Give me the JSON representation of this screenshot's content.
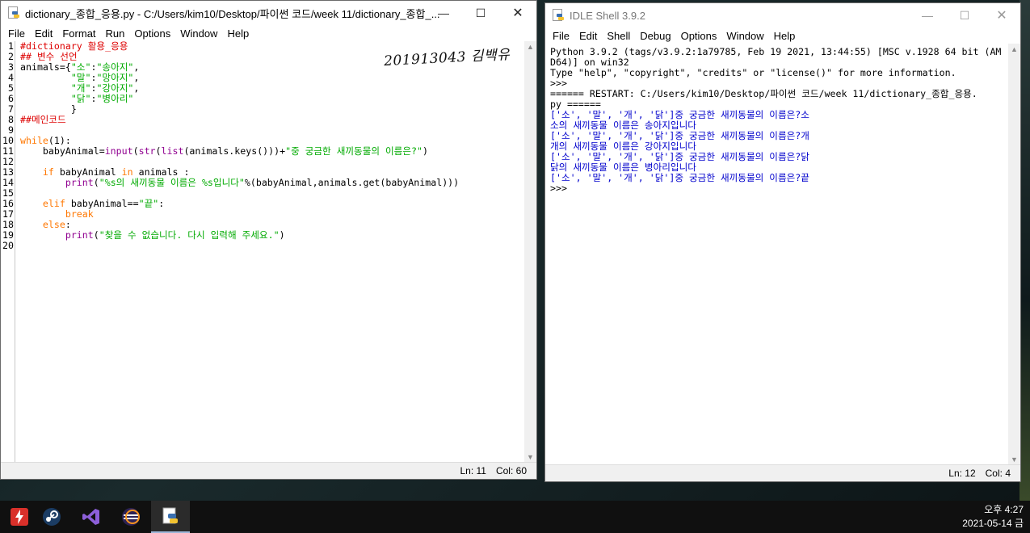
{
  "editor": {
    "title": "dictionary_종합_응용.py - C:/Users/kim10/Desktop/파이썬 코드/week 11/dictionary_종합_...",
    "menu": [
      "File",
      "Edit",
      "Format",
      "Run",
      "Options",
      "Window",
      "Help"
    ],
    "line_numbers": [
      "1",
      "2",
      "3",
      "4",
      "5",
      "6",
      "7",
      "8",
      "9",
      "10",
      "11",
      "12",
      "13",
      "14",
      "15",
      "16",
      "17",
      "18",
      "19",
      "20"
    ],
    "signature": "201913043 김백유",
    "status": {
      "ln": "Ln: 11",
      "col": "Col: 60"
    },
    "code_lines": [
      [
        {
          "c": "cmt",
          "t": "#dictionary 활용_응용"
        }
      ],
      [
        {
          "c": "cmt",
          "t": "## 변수 선언"
        }
      ],
      [
        {
          "c": "df",
          "t": "animals={"
        },
        {
          "c": "str",
          "t": "\"소\""
        },
        {
          "c": "df",
          "t": ":"
        },
        {
          "c": "str",
          "t": "\"송아지\""
        },
        {
          "c": "df",
          "t": ","
        }
      ],
      [
        {
          "c": "df",
          "t": "         "
        },
        {
          "c": "str",
          "t": "\"말\""
        },
        {
          "c": "df",
          "t": ":"
        },
        {
          "c": "str",
          "t": "\"망아지\""
        },
        {
          "c": "df",
          "t": ","
        }
      ],
      [
        {
          "c": "df",
          "t": "         "
        },
        {
          "c": "str",
          "t": "\"개\""
        },
        {
          "c": "df",
          "t": ":"
        },
        {
          "c": "str",
          "t": "\"강아지\""
        },
        {
          "c": "df",
          "t": ","
        }
      ],
      [
        {
          "c": "df",
          "t": "         "
        },
        {
          "c": "str",
          "t": "\"닭\""
        },
        {
          "c": "df",
          "t": ":"
        },
        {
          "c": "str",
          "t": "\"병아리\""
        }
      ],
      [
        {
          "c": "df",
          "t": "         }"
        }
      ],
      [
        {
          "c": "cmt",
          "t": "##메인코드"
        }
      ],
      [
        {
          "c": "df",
          "t": ""
        }
      ],
      [
        {
          "c": "kw",
          "t": "while"
        },
        {
          "c": "df",
          "t": "(1):"
        }
      ],
      [
        {
          "c": "df",
          "t": "    babyAnimal="
        },
        {
          "c": "bi",
          "t": "input"
        },
        {
          "c": "df",
          "t": "("
        },
        {
          "c": "bi",
          "t": "str"
        },
        {
          "c": "df",
          "t": "("
        },
        {
          "c": "bi",
          "t": "list"
        },
        {
          "c": "df",
          "t": "(animals.keys()))+"
        },
        {
          "c": "str",
          "t": "\"중 궁금한 새끼동물의 이름은?\""
        },
        {
          "c": "df",
          "t": ")"
        }
      ],
      [
        {
          "c": "df",
          "t": ""
        }
      ],
      [
        {
          "c": "df",
          "t": "    "
        },
        {
          "c": "kw",
          "t": "if"
        },
        {
          "c": "df",
          "t": " babyAnimal "
        },
        {
          "c": "kw",
          "t": "in"
        },
        {
          "c": "df",
          "t": " animals :"
        }
      ],
      [
        {
          "c": "df",
          "t": "        "
        },
        {
          "c": "bi",
          "t": "print"
        },
        {
          "c": "df",
          "t": "("
        },
        {
          "c": "str",
          "t": "\"%s의 새끼동물 이름은 %s입니다\""
        },
        {
          "c": "df",
          "t": "%(babyAnimal,animals.get(babyAnimal)))"
        }
      ],
      [
        {
          "c": "df",
          "t": ""
        }
      ],
      [
        {
          "c": "df",
          "t": "    "
        },
        {
          "c": "kw",
          "t": "elif"
        },
        {
          "c": "df",
          "t": " babyAnimal=="
        },
        {
          "c": "str",
          "t": "\"끝\""
        },
        {
          "c": "df",
          "t": ":"
        }
      ],
      [
        {
          "c": "df",
          "t": "        "
        },
        {
          "c": "kw",
          "t": "break"
        }
      ],
      [
        {
          "c": "df",
          "t": "    "
        },
        {
          "c": "kw",
          "t": "else"
        },
        {
          "c": "df",
          "t": ":"
        }
      ],
      [
        {
          "c": "df",
          "t": "        "
        },
        {
          "c": "bi",
          "t": "print"
        },
        {
          "c": "df",
          "t": "("
        },
        {
          "c": "str",
          "t": "\"찾을 수 없습니다. 다시 입력해 주세요.\""
        },
        {
          "c": "df",
          "t": ")"
        }
      ],
      [
        {
          "c": "df",
          "t": ""
        }
      ]
    ]
  },
  "shell": {
    "title": "IDLE Shell 3.9.2",
    "menu": [
      "File",
      "Edit",
      "Shell",
      "Debug",
      "Options",
      "Window",
      "Help"
    ],
    "status": {
      "ln": "Ln: 12",
      "col": "Col: 4"
    },
    "lines": [
      [
        {
          "c": "out",
          "t": "Python 3.9.2 (tags/v3.9.2:1a79785, Feb 19 2021, 13:44:55) [MSC v.1928 64 bit (AM"
        }
      ],
      [
        {
          "c": "out",
          "t": "D64)] on win32"
        }
      ],
      [
        {
          "c": "out",
          "t": "Type \"help\", \"copyright\", \"credits\" or \"license()\" for more information."
        }
      ],
      [
        {
          "c": "out",
          "t": ">>> "
        }
      ],
      [
        {
          "c": "restart",
          "t": "====== RESTART: C:/Users/kim10/Desktop/파이썬 코드/week 11/dictionary_종합_응용."
        }
      ],
      [
        {
          "c": "restart",
          "t": "py ======"
        }
      ],
      [
        {
          "c": "sout",
          "t": "['소', '말', '개', '닭']중 궁금한 새끼동물의 이름은?소"
        }
      ],
      [
        {
          "c": "sout",
          "t": "소의 새끼동물 이름은 송아지입니다"
        }
      ],
      [
        {
          "c": "sout",
          "t": "['소', '말', '개', '닭']중 궁금한 새끼동물의 이름은?개"
        }
      ],
      [
        {
          "c": "sout",
          "t": "개의 새끼동물 이름은 강아지입니다"
        }
      ],
      [
        {
          "c": "sout",
          "t": "['소', '말', '개', '닭']중 궁금한 새끼동물의 이름은?닭"
        }
      ],
      [
        {
          "c": "sout",
          "t": "닭의 새끼동물 이름은 병아리입니다"
        }
      ],
      [
        {
          "c": "sout",
          "t": "['소', '말', '개', '닭']중 궁금한 새끼동물의 이름은?끝"
        }
      ],
      [
        {
          "c": "out",
          "t": ">>> "
        }
      ]
    ]
  },
  "window_controls": {
    "minimize": "—",
    "maximize": "☐",
    "close": "✕"
  },
  "taskbar": {
    "apps": [
      "app-red-bolt-icon",
      "steam-icon",
      "visual-studio-icon",
      "eclipse-icon",
      "python-idle-icon"
    ],
    "time": "오후 4:27",
    "date": "2021-05-14 금"
  }
}
